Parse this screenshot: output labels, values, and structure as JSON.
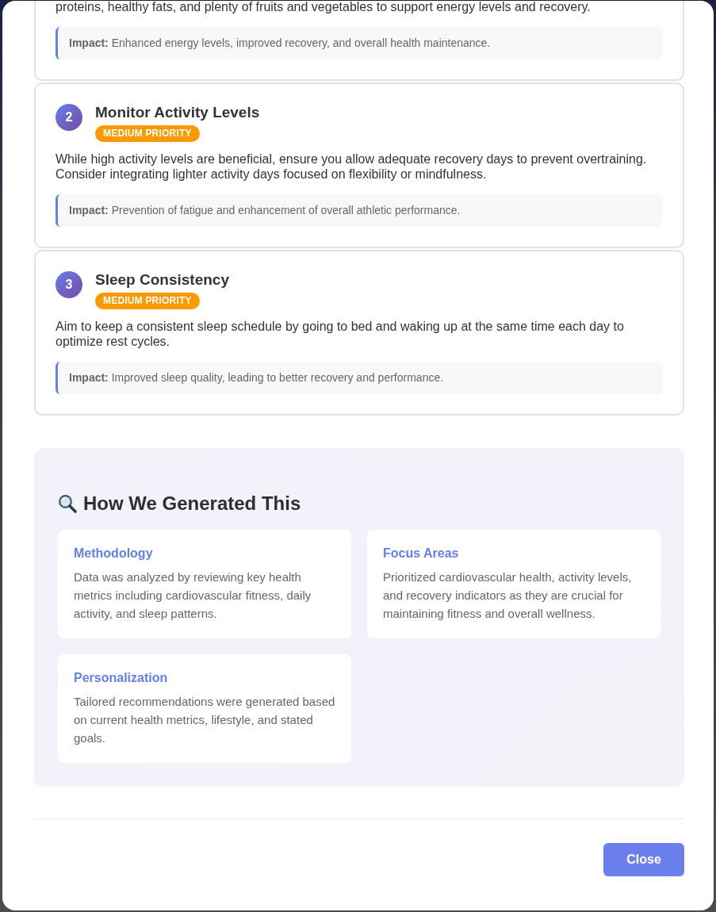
{
  "recommendations": [
    {
      "description": "proteins, healthy fats, and plenty of fruits and vegetables to support energy levels and recovery.",
      "impact": "**Impact:** Enhanced energy levels, improved recovery, and overall health maintenance."
    },
    {
      "number": "2",
      "title": "Monitor Activity Levels",
      "priority": "MEDIUM PRIORITY",
      "description": "While high activity levels are beneficial, ensure you allow adequate recovery days to prevent overtraining. Consider integrating lighter activity days focused on flexibility or mindfulness.",
      "impact": "**Impact:** Prevention of fatigue and enhancement of overall athletic performance."
    },
    {
      "number": "3",
      "title": "Sleep Consistency",
      "priority": "MEDIUM PRIORITY",
      "description": "Aim to keep a consistent sleep schedule by going to bed and waking up at the same time each day to optimize rest cycles.",
      "impact": "**Impact:** Improved sleep quality, leading to better recovery and performance."
    }
  ],
  "how_we_generated": {
    "heading": "How We Generated This",
    "cards": [
      {
        "title": "Methodology",
        "text": "Data was analyzed by reviewing key health metrics including cardiovascular fitness, daily activity, and sleep patterns."
      },
      {
        "title": "Focus Areas",
        "text": "Prioritized cardiovascular health, activity levels, and recovery indicators as they are crucial for maintaining fitness and overall wellness."
      },
      {
        "title": "Personalization",
        "text": "Tailored recommendations were generated based on current health metrics, lifestyle, and stated goals."
      }
    ]
  },
  "footer": {
    "close_button": "Close"
  }
}
